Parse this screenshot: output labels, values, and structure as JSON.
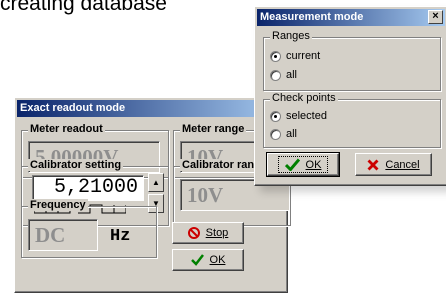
{
  "background_text": "creating database",
  "exact_window": {
    "title": "Exact readout mode",
    "meter_readout": {
      "label": "Meter readout",
      "value": "5,00000V"
    },
    "meter_range": {
      "label": "Meter range",
      "value": "10V"
    },
    "calibrator_setting": {
      "label": "Calibrator setting",
      "value": "5,21000"
    },
    "calibrator_range": {
      "label": "Calibrator range",
      "value": "10V"
    },
    "frequency": {
      "label": "Frequency",
      "value": "DC",
      "unit": "Hz"
    },
    "stop_button": {
      "label": "Stop",
      "icon": "stop-circle-icon",
      "color": "#cc0000"
    },
    "ok_button": {
      "label": "OK",
      "icon": "check-icon",
      "color": "#008000"
    }
  },
  "measure_window": {
    "title": "Measurement mode",
    "close_glyph": "×",
    "ranges": {
      "label": "Ranges",
      "options": [
        "current",
        "all"
      ],
      "selected": "current"
    },
    "check_points": {
      "label": "Check points",
      "options": [
        "selected",
        "all"
      ],
      "selected": "selected"
    },
    "ok_button": {
      "label": "OK",
      "icon": "check-icon",
      "color": "#008000"
    },
    "cancel_button": {
      "label": "Cancel",
      "icon": "x-icon",
      "color": "#cc0000"
    }
  }
}
